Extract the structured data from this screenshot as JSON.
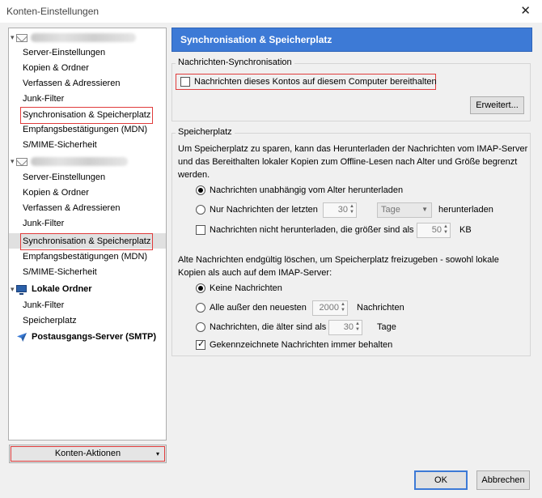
{
  "window": {
    "title": "Konten-Einstellungen",
    "close_glyph": "✕"
  },
  "tree": {
    "account1": {
      "items": [
        "Server-Einstellungen",
        "Kopien & Ordner",
        "Verfassen & Adressieren",
        "Junk-Filter",
        "Synchronisation & Speicherplatz",
        "Empfangsbestätigungen (MDN)",
        "S/MIME-Sicherheit"
      ]
    },
    "account2": {
      "items": [
        "Server-Einstellungen",
        "Kopien & Ordner",
        "Verfassen & Adressieren",
        "Junk-Filter",
        "Synchronisation & Speicherplatz",
        "Empfangsbestätigungen (MDN)",
        "S/MIME-Sicherheit"
      ]
    },
    "local": {
      "label": "Lokale Ordner",
      "items": [
        "Junk-Filter",
        "Speicherplatz"
      ]
    },
    "smtp": {
      "label": "Postausgangs-Server (SMTP)"
    }
  },
  "account_actions": {
    "label": "Konten-Aktionen",
    "arrow": "▾"
  },
  "panel": {
    "header": "Synchronisation & Speicherplatz",
    "sync": {
      "legend": "Nachrichten-Synchronisation",
      "keep_local": {
        "label": "Nachrichten dieses Kontos auf diesem Computer bereithalten",
        "checked": false
      },
      "advanced_button": "Erweitert..."
    },
    "storage": {
      "legend": "Speicherplatz",
      "description": "Um Speicherplatz zu sparen, kann das Herunterladen der Nachrichten vom IMAP-Server und das Bereithalten lokaler Kopien zum Offline-Lesen nach Alter und Größe begrenzt werden.",
      "download_all": {
        "label": "Nachrichten unabhängig vom Alter herunterladen",
        "selected": true
      },
      "download_last": {
        "label": "Nur Nachrichten der letzten",
        "value": "30",
        "unit": "Tage",
        "suffix": "herunterladen",
        "selected": false
      },
      "size_limit": {
        "label": "Nachrichten nicht herunterladen, die größer sind als",
        "value": "50",
        "unit": "KB",
        "checked": false
      },
      "delete_description": "Alte Nachrichten endgültig löschen, um Speicherplatz freizugeben - sowohl lokale Kopien als auch auf dem IMAP-Server:",
      "delete_none": {
        "label": "Keine Nachrichten",
        "selected": true
      },
      "delete_all_but": {
        "label": "Alle außer den neuesten",
        "value": "2000",
        "suffix": "Nachrichten",
        "selected": false
      },
      "delete_older": {
        "label": "Nachrichten, die älter sind als",
        "value": "30",
        "suffix": "Tage",
        "selected": false
      },
      "keep_flagged": {
        "label": "Gekennzeichnete Nachrichten immer behalten",
        "checked": true
      }
    }
  },
  "buttons": {
    "ok": "OK",
    "cancel": "Abbrechen"
  },
  "colors": {
    "header_bg": "#3d7ad6",
    "highlight_border": "#e03c3c"
  }
}
